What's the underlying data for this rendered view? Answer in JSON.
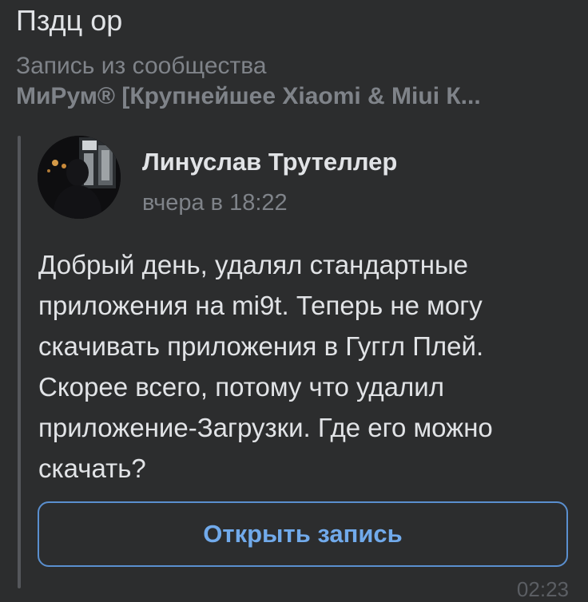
{
  "chat": {
    "title": "Пздц ор"
  },
  "repost": {
    "label": "Запись из сообщества",
    "source_name": "МиРум® [Крупнейшее Xiaomi & Miui К..."
  },
  "post": {
    "author": "Линуслав Трутеллер",
    "time": "вчера в 18:22",
    "text": "Добрый день, удалял стандартные приложения на mi9t. Теперь не могу скачивать приложения в Гуггл Плей. Скорее всего, потому что удалил приложение-Загрузки. Где его можно скачать?",
    "open_button_label": "Открыть запись"
  },
  "message": {
    "time": "02:23"
  },
  "colors": {
    "background": "#2c2d2e",
    "text_primary": "#e1e3e6",
    "text_secondary": "#7f8389",
    "accent": "#71aaeb"
  }
}
